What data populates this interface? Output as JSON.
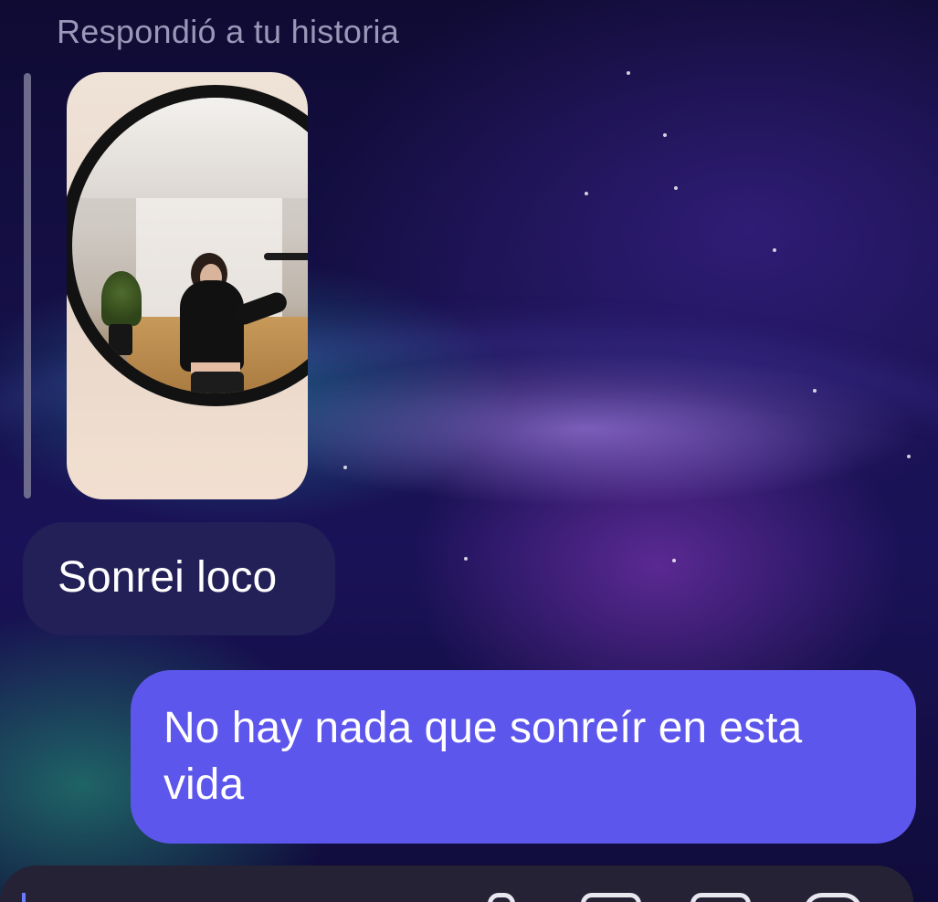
{
  "conversation": {
    "reply_context_label": "Respondió a tu historia",
    "story_thumbnail": {
      "description_icon": "story-image"
    },
    "messages": [
      {
        "direction": "incoming",
        "text": "Sonrei loco"
      },
      {
        "direction": "outgoing",
        "text": "No hay nada que sonreír en esta vida"
      }
    ]
  },
  "composer": {
    "icons": [
      "microphone-icon",
      "image-icon",
      "sticker-icon",
      "plus-icon"
    ]
  },
  "colors": {
    "incoming_bubble": "#231f57",
    "outgoing_bubble": "#5d56ec",
    "reply_label": "#9a97b8",
    "composer_bg": "#262236"
  }
}
